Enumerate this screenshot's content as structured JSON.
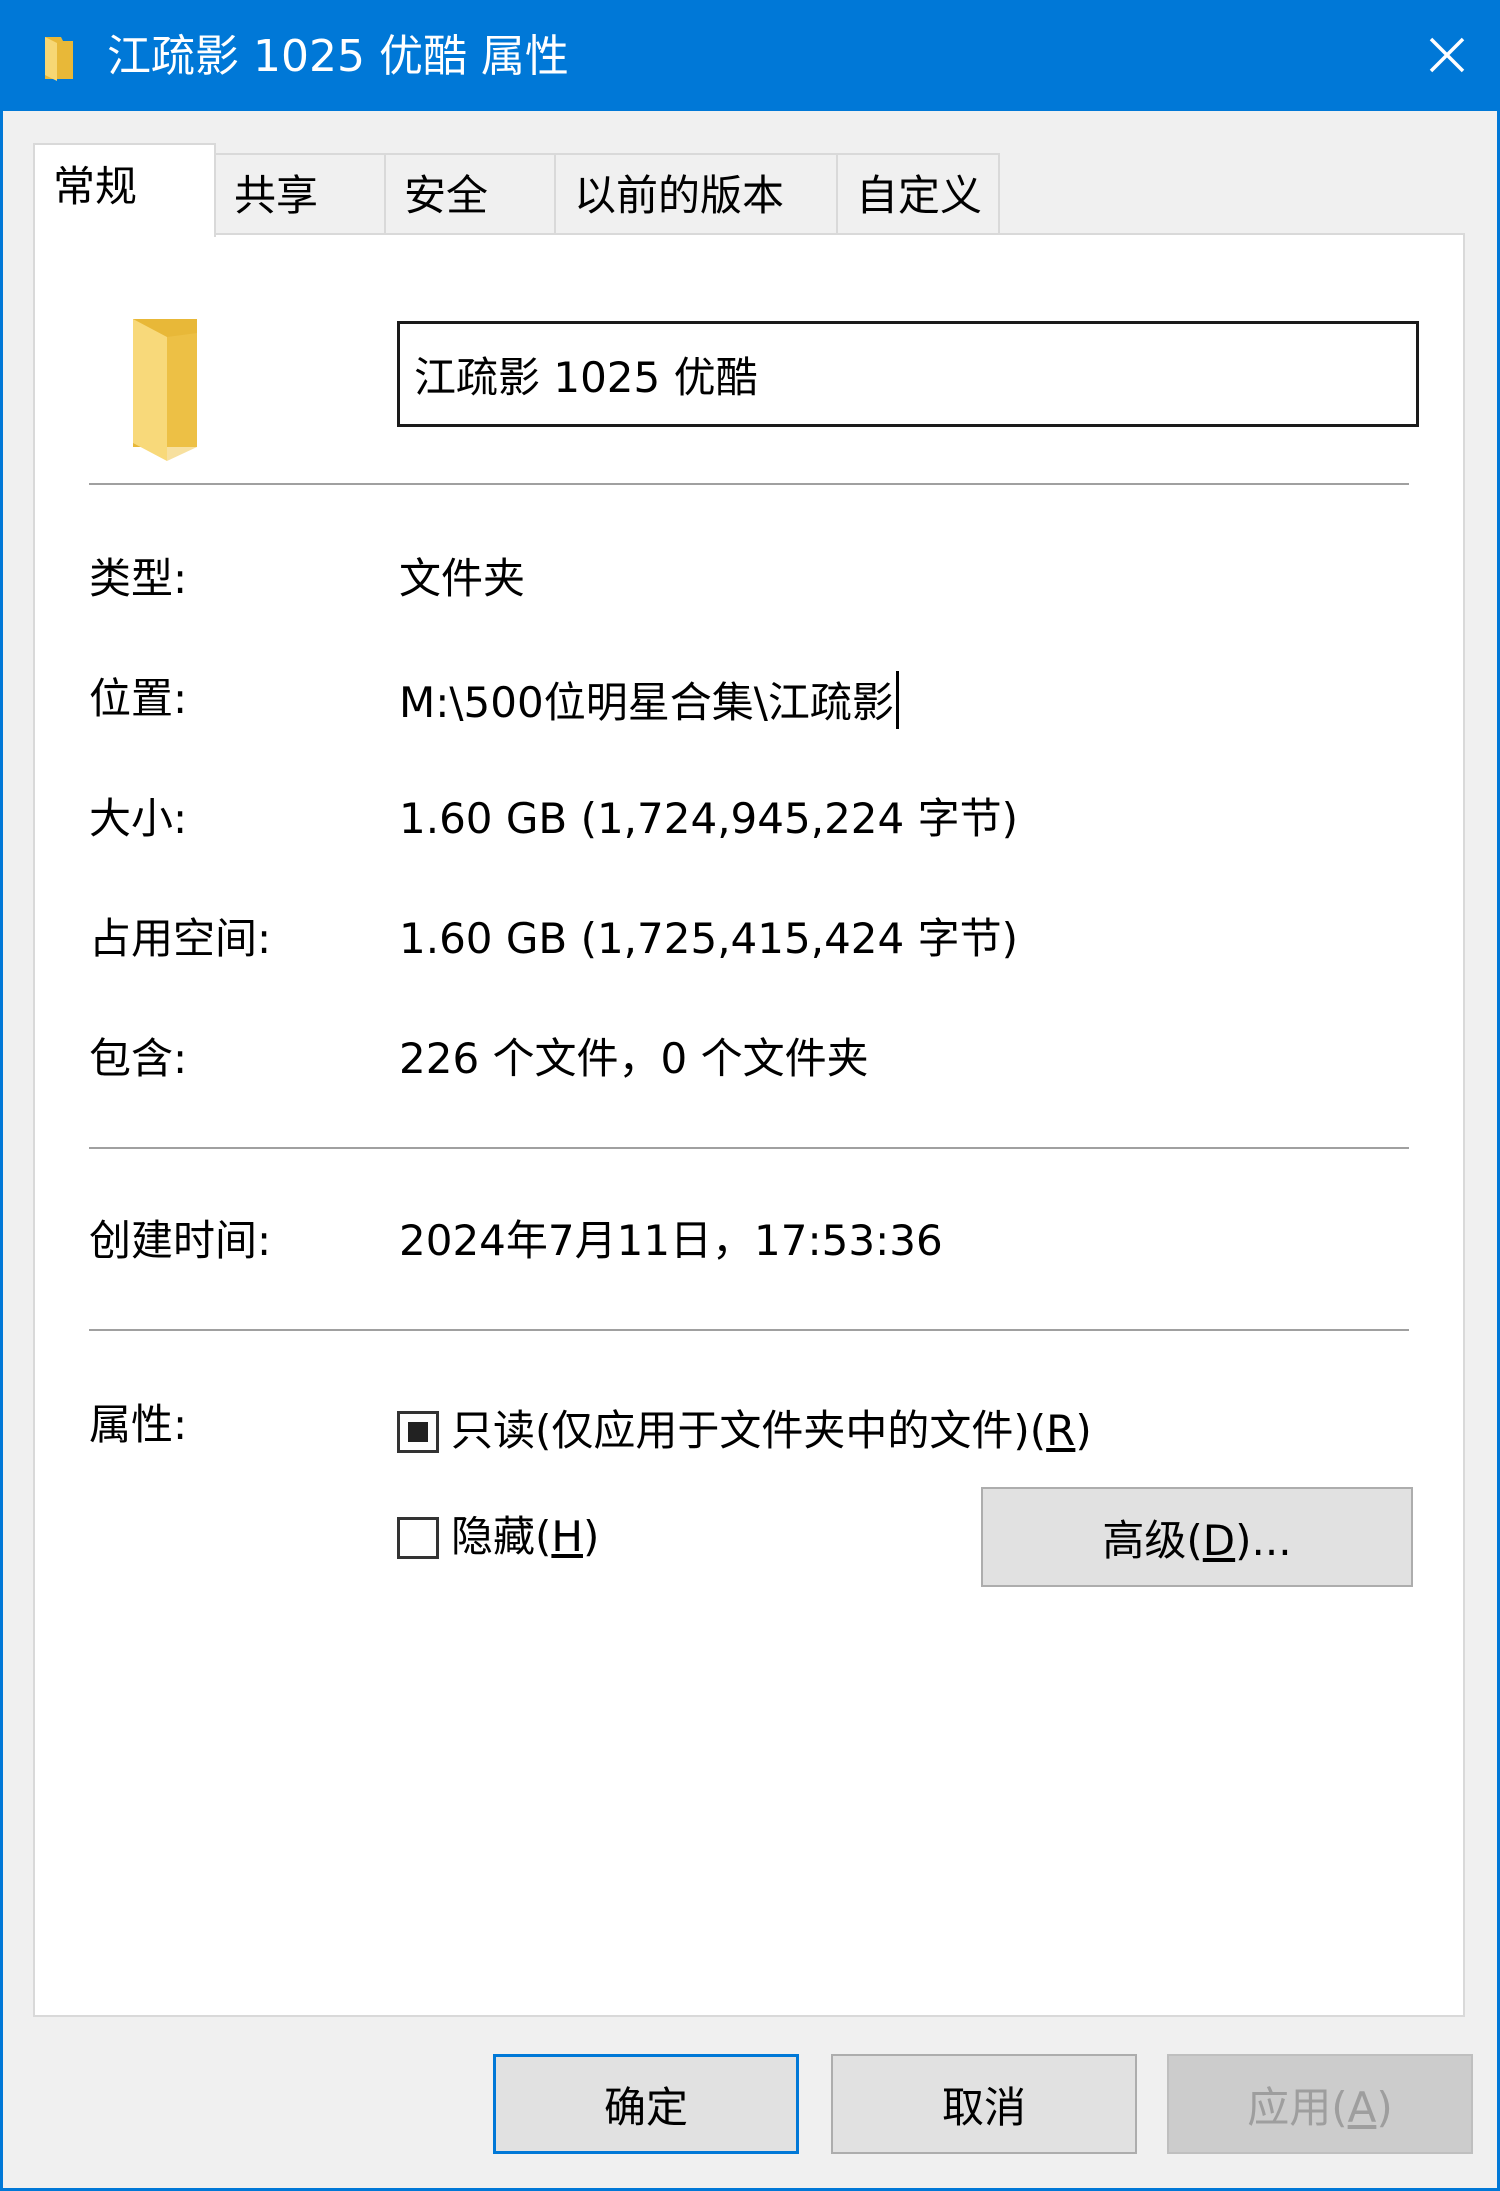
{
  "window": {
    "title": "江疏影 1025 优酷 属性",
    "colors": {
      "titlebar": "#0078d7",
      "body": "#f0f0f0",
      "panel": "#ffffff"
    },
    "icons": {
      "title": "folder-icon",
      "close": "close-icon"
    }
  },
  "tabs": [
    {
      "label": "常规",
      "active": true
    },
    {
      "label": "共享",
      "active": false
    },
    {
      "label": "安全",
      "active": false
    },
    {
      "label": "以前的版本",
      "active": false
    },
    {
      "label": "自定义",
      "active": false
    }
  ],
  "general": {
    "name_value": "江疏影 1025 优酷",
    "type": {
      "label": "类型:",
      "value": "文件夹"
    },
    "location": {
      "label": "位置:",
      "value": "M:\\500位明星合集\\江疏影"
    },
    "size": {
      "label": "大小:",
      "value": "1.60 GB (1,724,945,224 字节)"
    },
    "size_on_disk": {
      "label": "占用空间:",
      "value": "1.60 GB (1,725,415,424 字节)"
    },
    "contains": {
      "label": "包含:",
      "value": "226 个文件，0 个文件夹"
    },
    "created": {
      "label": "创建时间:",
      "value": "2024年7月11日，17:53:36"
    },
    "attributes": {
      "label": "属性:",
      "readonly": {
        "text": "只读(仅应用于文件夹中的文件)(",
        "key": "R",
        "suffix": ")",
        "state": "indeterminate"
      },
      "hidden": {
        "text": "隐藏(",
        "key": "H",
        "suffix": ")",
        "state": "unchecked"
      },
      "advanced": {
        "text": "高级(",
        "key": "D",
        "suffix": ")..."
      }
    }
  },
  "buttons": {
    "ok": "确定",
    "cancel": "取消",
    "apply_text": "应用(",
    "apply_key": "A",
    "apply_suffix": ")"
  }
}
